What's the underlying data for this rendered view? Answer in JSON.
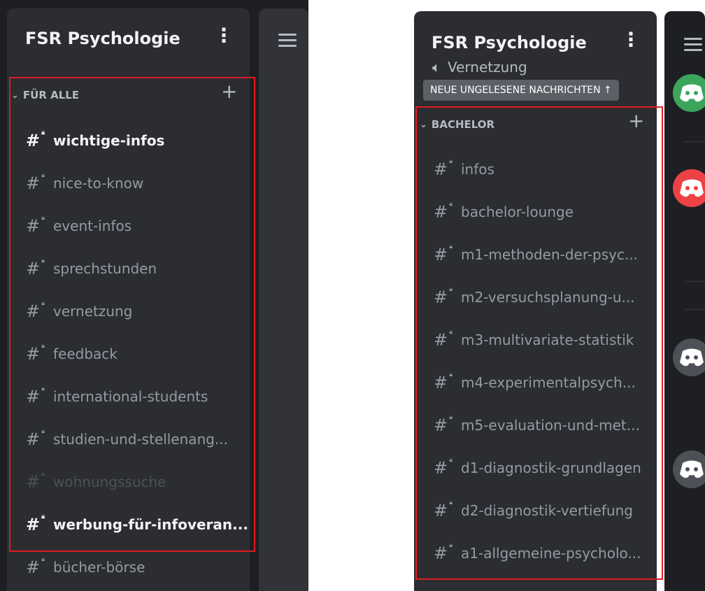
{
  "left": {
    "server_title": "FSR Psychologie",
    "category": "FÜR ALLE",
    "channels": [
      {
        "label": "wichtige-infos",
        "state": "unread"
      },
      {
        "label": "nice-to-know",
        "state": "normal"
      },
      {
        "label": "event-infos",
        "state": "normal"
      },
      {
        "label": "sprechstunden",
        "state": "normal"
      },
      {
        "label": "vernetzung",
        "state": "normal"
      },
      {
        "label": "feedback",
        "state": "normal"
      },
      {
        "label": "international-students",
        "state": "normal"
      },
      {
        "label": "studien-und-stellenang...",
        "state": "normal"
      },
      {
        "label": "wohnungssuche",
        "state": "muted"
      },
      {
        "label": "werbung-für-infoveran...",
        "state": "unread"
      },
      {
        "label": "bücher-börse",
        "state": "normal"
      }
    ]
  },
  "right": {
    "server_title": "FSR Psychologie",
    "scrolled_channel": "Vernetzung",
    "new_unread_pill": "NEUE UNGELESENE NACHRICHTEN ↑",
    "category": "BACHELOR",
    "channels": [
      {
        "label": "infos"
      },
      {
        "label": "bachelor-lounge"
      },
      {
        "label": "m1-methoden-der-psyc..."
      },
      {
        "label": "m2-versuchsplanung-u..."
      },
      {
        "label": "m3-multivariate-statistik"
      },
      {
        "label": "m4-experimentalpsych..."
      },
      {
        "label": "m5-evaluation-und-met..."
      },
      {
        "label": "d1-diagnostik-grundlagen"
      },
      {
        "label": "d2-diagnostik-vertiefung"
      },
      {
        "label": "a1-allgemeine-psycholo..."
      }
    ],
    "avatar_colors": [
      "#3ba55c",
      "#ed4245",
      "#4e5058",
      "#4e5058"
    ]
  },
  "colors": {
    "highlight": "#e01b24",
    "sidebar_bg": "#2b2d31",
    "outer_bg": "#1e1f22"
  }
}
